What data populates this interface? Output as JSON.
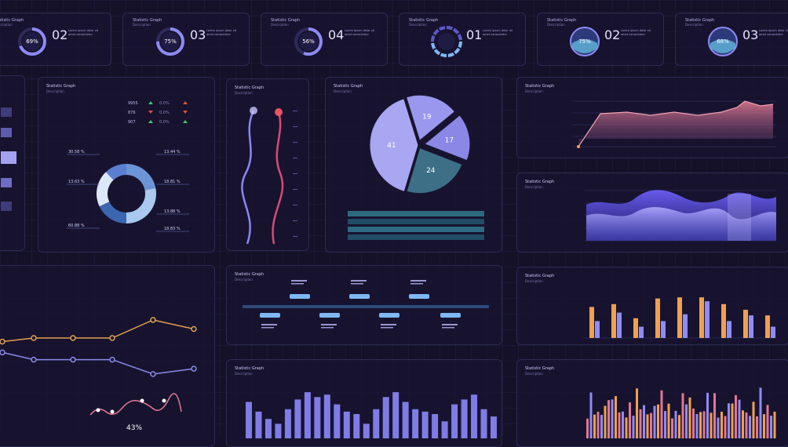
{
  "panel_title": "Statistic Graph",
  "panel_subtitle": "Description",
  "kpis": [
    {
      "percent": "69%",
      "number": "02",
      "fill": 0.69,
      "style": "ring"
    },
    {
      "percent": "75%",
      "number": "03",
      "fill": 0.75,
      "style": "ring"
    },
    {
      "percent": "56%",
      "number": "04",
      "fill": 0.56,
      "style": "ring"
    },
    {
      "percent": "",
      "number": "01",
      "fill": 0.5,
      "style": "segmented"
    },
    {
      "percent": "75%",
      "number": "02",
      "fill": 0.75,
      "style": "globe"
    },
    {
      "percent": "68%",
      "number": "03",
      "fill": 0.68,
      "style": "globe"
    }
  ],
  "kpi_desc": "Lorem ipsum dolor sit amet consectetur",
  "donut": {
    "labels_left": [
      "30.58 %",
      "13.63 %",
      "60.88 %"
    ],
    "labels_right": [
      "13.44 %",
      "18.81 %",
      "13.88 %",
      "18.83 %"
    ],
    "legend": [
      {
        "name": "9955",
        "status": "up"
      },
      {
        "name": "876",
        "status": "down"
      },
      {
        "name": "907",
        "status": "up"
      }
    ],
    "legend_value": "0.0%"
  },
  "pie": {
    "slices": [
      {
        "label": "19",
        "value": 19,
        "color": "#9a97ee"
      },
      {
        "label": "17",
        "value": 17,
        "color": "#8a87e6"
      },
      {
        "label": "24",
        "value": 24,
        "color": "#3d6f86"
      },
      {
        "label": "41",
        "value": 41,
        "color": "#a9a6f2"
      }
    ],
    "table_rows": 4
  },
  "line_panel": {
    "orange": [
      0.42,
      0.4,
      0.4,
      0.4,
      0.3,
      0.35
    ],
    "blue": [
      0.48,
      0.52,
      0.52,
      0.52,
      0.6,
      0.57
    ],
    "footer_percent": "43%"
  },
  "timeline": {
    "items": 8
  },
  "wave": {
    "series": 2
  },
  "bars_grouped": {
    "orange": [
      0.55,
      0.6,
      0.35,
      0.7,
      0.72,
      0.72,
      0.6,
      0.5,
      0.4
    ],
    "pink": [
      0.3,
      0.45,
      0.2,
      0.3,
      0.42,
      0.65,
      0.3,
      0.4,
      0.2
    ]
  },
  "bars_single": [
    0.75,
    0.55,
    0.4,
    0.3,
    0.6,
    0.8,
    0.95,
    0.85,
    0.9,
    0.7,
    0.55,
    0.5,
    0.3,
    0.6,
    0.85,
    0.95,
    0.75,
    0.6,
    0.55,
    0.5,
    0.35,
    0.7,
    0.8,
    0.9,
    0.6,
    0.45
  ]
}
